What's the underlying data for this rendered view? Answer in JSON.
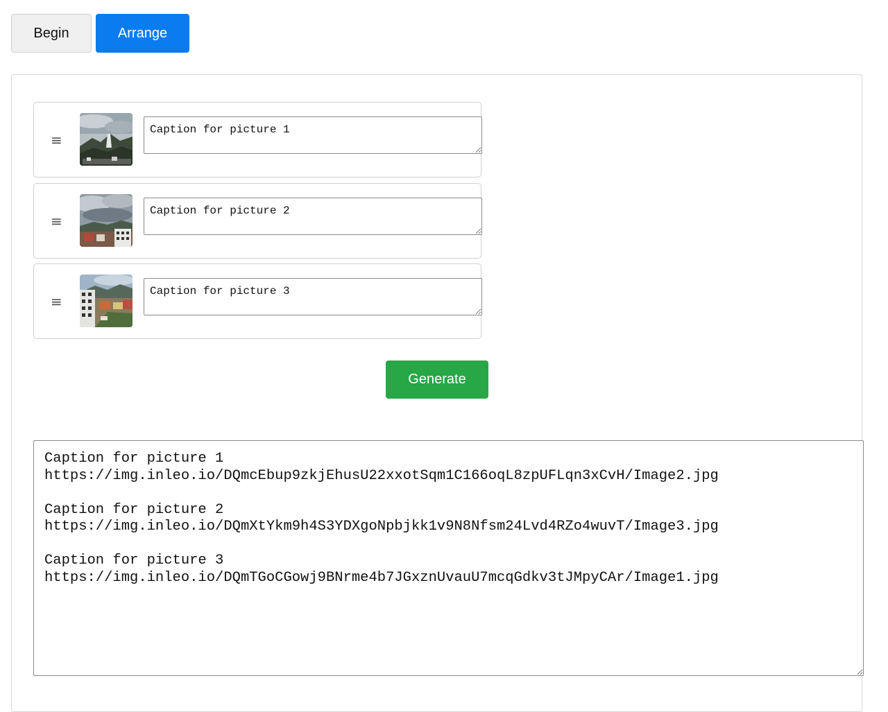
{
  "tabs": {
    "begin_label": "Begin",
    "arrange_label": "Arrange",
    "active": "Arrange"
  },
  "pictures": [
    {
      "caption": "Caption for picture 1",
      "thumb_icon": "mountain-photo-icon"
    },
    {
      "caption": "Caption for picture 2",
      "thumb_icon": "cloudy-city-photo-icon"
    },
    {
      "caption": "Caption for picture 3",
      "thumb_icon": "town-street-photo-icon"
    }
  ],
  "drag_handle_glyph": "≡",
  "generate_label": "Generate",
  "output_text": "Caption for picture 1\nhttps://img.inleo.io/DQmcEbup9zkjEhusU22xxotSqm1C166oqL8zpUFLqn3xCvH/Image2.jpg\n\nCaption for picture 2\nhttps://img.inleo.io/DQmXtYkm9h4S3YDXgoNpbjkk1v9N8Nfsm24Lvd4RZo4wuvT/Image3.jpg\n\nCaption for picture 3\nhttps://img.inleo.io/DQmTGoCGowj9BNrme4b7JGxznUvauU7mcqGdkv3tJMpyCAr/Image1.jpg",
  "colors": {
    "arrange_active": "#0a7cf0",
    "generate": "#27a745"
  }
}
